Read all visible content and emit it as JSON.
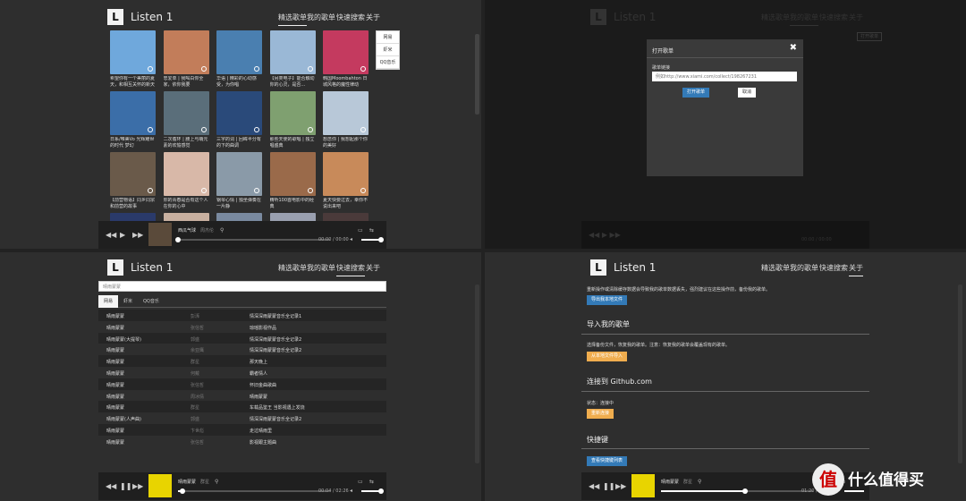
{
  "app": {
    "logo": "L",
    "title": "Listen 1"
  },
  "nav": [
    "精选歌单",
    "我的歌单",
    "快速搜索",
    "关于"
  ],
  "q1": {
    "covers": [
      {
        "color": "#6fa8dc",
        "cap": "希望你有一个美丽的夏天，和相互关怀的新天"
      },
      {
        "color": "#c27d5a",
        "cap": "忠爱单 | 我喝白你全家，依你我要"
      },
      {
        "color": "#4a7fb0",
        "cap": "华语 | 精彩的心动感受，为你唱"
      },
      {
        "color": "#9ab8d6",
        "cap": "【另类电子】能否触动你的心灵，是否..."
      },
      {
        "color": "#c43a5f",
        "cap": "韩国Moombahton 日城风格的魔性律动"
      },
      {
        "color": "#3b6ea8",
        "cap": "日系/唯美Vo 光辉耀世的时代 梦幻"
      },
      {
        "color": "#5a6e7a",
        "cap": "二次循环 | 腰上与萌元素的欢愉感觉"
      },
      {
        "color": "#2a4a7a",
        "cap": "三字的词 | 回眸半分有的下的曲调"
      },
      {
        "color": "#7fa070",
        "cap": "那些天使的歌唱 | 独立唱盛典"
      },
      {
        "color": "#b8c8d8",
        "cap": "想念你 | 我想起那个你的美好"
      },
      {
        "color": "#6a5a4a",
        "cap": "【前营物语】同乡同宗和前营的故事"
      },
      {
        "color": "#d8b8a8",
        "cap": "你的青春是否有这个人在你的心中"
      },
      {
        "color": "#8a9aa8",
        "cap": "钢琴心情 | 独坐弹奏在一片静"
      },
      {
        "color": "#9a6a4a",
        "cap": "精听100首电影中的经典"
      },
      {
        "color": "#c88a5a",
        "cap": "夏天快要过去，幸你不说出来吧"
      },
      {
        "color": "#2a3a6a",
        "cap": ""
      },
      {
        "color": "#c8b0a0",
        "cap": ""
      },
      {
        "color": "#7a8aa0",
        "cap": ""
      },
      {
        "color": "#9aa0b0",
        "cap": ""
      },
      {
        "color": "#4a3a3a",
        "cap": ""
      }
    ],
    "sources": [
      "网易",
      "虾米",
      "QQ音乐"
    ],
    "player": {
      "song": "西瓜气球",
      "artist": "周杰伦",
      "time": "00:00 / 00:00",
      "progress": 0
    }
  },
  "q2": {
    "modal_title": "打开歌单",
    "close": "✖",
    "label": "歌单链接",
    "placeholder": "例如http://www.xiami.com/collect/198267231",
    "ok": "打开歌单",
    "cancel": "取消",
    "dim_button": "打开歌单",
    "player": {
      "time": "00:00 / 00:00"
    }
  },
  "q3": {
    "search_value": "晴雨蒙蒙",
    "tabs": [
      "网易",
      "虾米",
      "QQ音乐"
    ],
    "rows": [
      [
        "晴雨蒙蒙",
        "彭湃",
        "情深深雨蒙蒙音乐全记录1"
      ],
      [
        "晴雨蒙蒙",
        "张信哲",
        "琼瑶影视作品"
      ],
      [
        "晴雨蒙蒙(大提琴)",
        "郭盛",
        "情深深雨蒙蒙音乐全记录2"
      ],
      [
        "晴雨蒙蒙",
        "余亚鹰",
        "情深深雨蒙蒙音乐全记录2"
      ],
      [
        "晴雨蒙蒙",
        "群星",
        "那天晚上"
      ],
      [
        "晴雨蒙蒙",
        "何戴",
        "霸者情人"
      ],
      [
        "晴雨蒙蒙",
        "张信哲",
        "怀旧金曲歌曲"
      ],
      [
        "晴雨蒙蒙",
        "周冰倩",
        "晴雨蒙蒙"
      ],
      [
        "晴雨蒙蒙",
        "群星",
        "车载品鉴王 当影视遇上发烧"
      ],
      [
        "晴雨蒙蒙(人声曲)",
        "郭盛",
        "情深深雨蒙蒙音乐全记录2"
      ],
      [
        "晴雨蒙蒙",
        "卞世彪",
        "走过晴雨里"
      ],
      [
        "晴雨蒙蒙",
        "张信哲",
        "影视跟主题曲"
      ]
    ],
    "player": {
      "song": "晴雨蒙蒙",
      "artist": "群星",
      "time": "00:04 / 02:26",
      "progress": 0.03
    }
  },
  "q4": {
    "intro": "重新操作或清除缓存数据会导致我的歌单数据丢失，强烈建议在这些操作前，备份我的歌单。",
    "export_btn": "导出我本地文件",
    "import_heading": "导入我的歌单",
    "import_text": "选择备份文件，恢复我的歌单。注意：恢复我的歌单会覆盖现有的歌单。",
    "import_btn": "从本地文件导入",
    "github_heading": "连接到 Github.com",
    "status_text": "状态：连接中",
    "github_btn": "重新连接",
    "shortcut_heading": "快捷键",
    "shortcut_btn": "查看快捷键列表",
    "player": {
      "song": "晴雨蒙蒙",
      "artist": "群星",
      "time": "01:20 / 02:26",
      "progress": 0.55
    }
  },
  "watermark": {
    "logo": "值",
    "text": "什么值得买"
  }
}
